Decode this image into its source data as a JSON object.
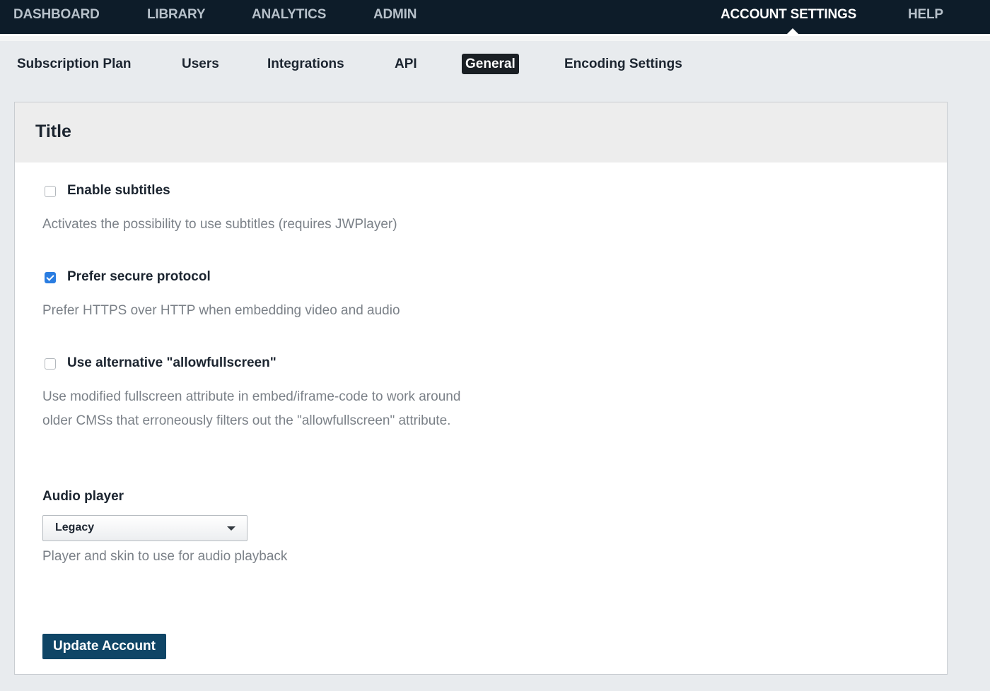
{
  "top_nav": {
    "items": [
      {
        "label": "DASHBOARD"
      },
      {
        "label": "LIBRARY"
      },
      {
        "label": "ANALYTICS"
      },
      {
        "label": "ADMIN"
      },
      {
        "label": "ACCOUNT SETTINGS",
        "active": true
      },
      {
        "label": "HELP"
      }
    ]
  },
  "sub_nav": {
    "items": [
      {
        "label": "Subscription Plan"
      },
      {
        "label": "Users"
      },
      {
        "label": "Integrations"
      },
      {
        "label": "API"
      },
      {
        "label": "General",
        "active": true
      },
      {
        "label": "Encoding Settings"
      }
    ]
  },
  "panel": {
    "title": "Title",
    "options": [
      {
        "label": "Enable subtitles",
        "checked": false,
        "description": "Activates the possibility to use subtitles (requires JWPlayer)"
      },
      {
        "label": "Prefer secure protocol",
        "checked": true,
        "description": "Prefer HTTPS over HTTP when embedding video and audio"
      },
      {
        "label": "Use alternative \"allowfullscreen\"",
        "checked": false,
        "description": "Use modified fullscreen attribute in embed/iframe-code to work around older CMSs that erroneously filters out the \"allowfullscreen\" attribute."
      }
    ],
    "audio_player": {
      "label": "Audio player",
      "selected": "Legacy",
      "description": "Player and skin to use for audio playback"
    },
    "submit_label": "Update Account"
  },
  "colors": {
    "top_nav_bg": "#0d1c29",
    "primary_button": "#0f4566",
    "checkbox_checked": "#2a7de1"
  }
}
